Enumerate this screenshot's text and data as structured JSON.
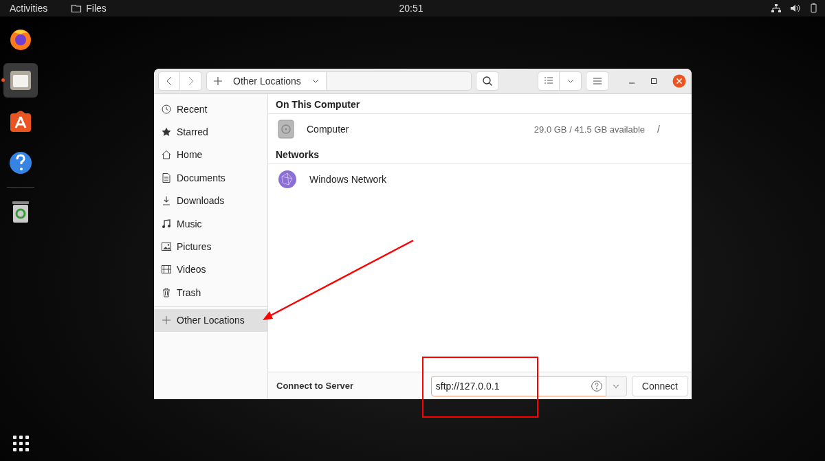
{
  "top_bar": {
    "activities": "Activities",
    "app_name": "Files",
    "clock": "20:51"
  },
  "dock": {
    "items": [
      {
        "running": false,
        "selected": false
      },
      {
        "running": true,
        "selected": true
      },
      {
        "running": false,
        "selected": false
      },
      {
        "running": false,
        "selected": false
      },
      {
        "running": false,
        "selected": false
      }
    ]
  },
  "window": {
    "toolbar": {
      "path": "Other Locations"
    },
    "sidebar": {
      "items": [
        {
          "label": "Recent",
          "selected": false
        },
        {
          "label": "Starred",
          "selected": false
        },
        {
          "label": "Home",
          "selected": false
        },
        {
          "label": "Documents",
          "selected": false
        },
        {
          "label": "Downloads",
          "selected": false
        },
        {
          "label": "Music",
          "selected": false
        },
        {
          "label": "Pictures",
          "selected": false
        },
        {
          "label": "Videos",
          "selected": false
        },
        {
          "label": "Trash",
          "selected": false
        }
      ],
      "footer_items": [
        {
          "label": "Other Locations",
          "selected": true
        }
      ]
    },
    "sections": [
      {
        "heading": "On This Computer",
        "rows": [
          {
            "name": "Computer",
            "info": "29.0 GB / 41.5 GB available",
            "mount": "/"
          }
        ]
      },
      {
        "heading": "Networks",
        "rows": [
          {
            "name": "Windows Network"
          }
        ]
      }
    ],
    "connect_bar": {
      "label": "Connect to Server",
      "address": "sftp://127.0.0.1",
      "button": "Connect"
    }
  }
}
